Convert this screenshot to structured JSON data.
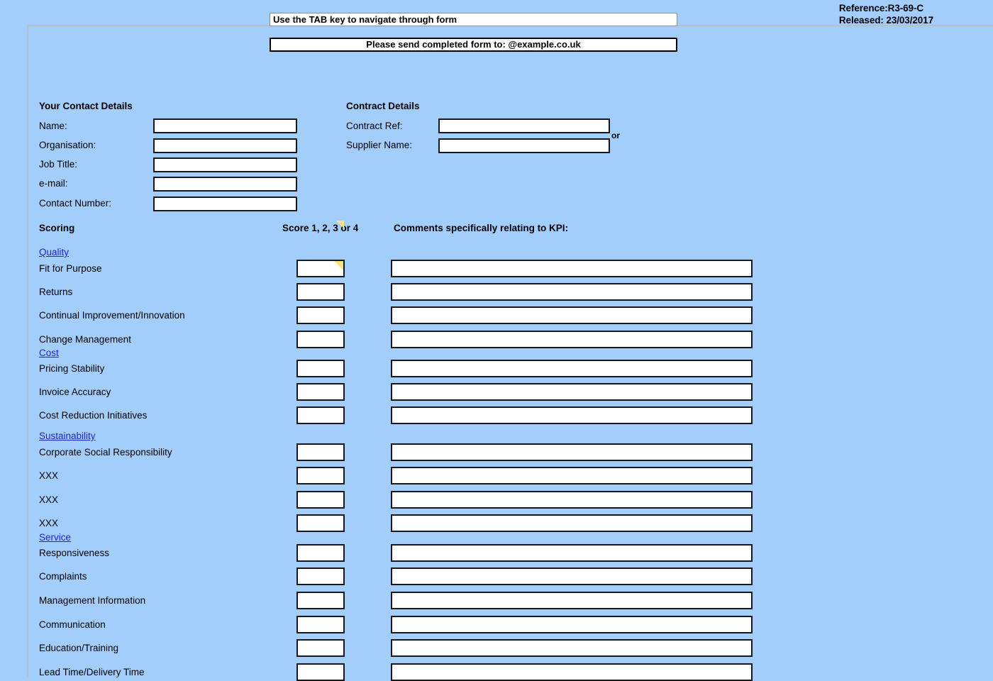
{
  "document": {
    "reference_label": "Reference:R3-69-C",
    "released_label": "Released: 23/03/2017"
  },
  "banners": {
    "tab_hint": "Use the TAB key to navigate through form",
    "send_to": "Please send completed form to: @example.co.uk"
  },
  "contact": {
    "heading": "Your Contact Details",
    "fields": [
      {
        "label": "Name:",
        "value": "",
        "placeholder": ""
      },
      {
        "label": "Organisation:",
        "value": "",
        "placeholder": ""
      },
      {
        "label": "Job Title:",
        "value": "",
        "placeholder": ""
      },
      {
        "label": "e-mail:",
        "value": "",
        "placeholder": ""
      },
      {
        "label": "Contact Number:",
        "value": "",
        "placeholder": ""
      }
    ]
  },
  "contract": {
    "heading": "Contract Details",
    "or_label": "or",
    "fields": [
      {
        "label": "Contract Ref:",
        "value": "",
        "placeholder": ""
      },
      {
        "label": "Supplier Name:",
        "value": "",
        "placeholder": ""
      }
    ]
  },
  "scoring": {
    "heading": "Scoring",
    "score_header": "Score 1, 2, 3 or 4",
    "comments_header": "Comments specifically relating to KPI:",
    "groups": [
      {
        "name": "Quality",
        "rows": [
          {
            "label": "Fit for Purpose",
            "score": "",
            "comment": "",
            "has_marker": true
          },
          {
            "label": "Returns",
            "score": "",
            "comment": "",
            "has_marker": false
          },
          {
            "label": "Continual Improvement/Innovation",
            "score": "",
            "comment": "",
            "has_marker": false
          },
          {
            "label": "Change Management",
            "score": "",
            "comment": "",
            "has_marker": false
          }
        ]
      },
      {
        "name": "Cost",
        "rows": [
          {
            "label": "Pricing Stability",
            "score": "",
            "comment": "",
            "has_marker": false
          },
          {
            "label": "Invoice Accuracy",
            "score": "",
            "comment": "",
            "has_marker": false
          },
          {
            "label": "Cost Reduction Initiatives",
            "score": "",
            "comment": "",
            "has_marker": false
          }
        ]
      },
      {
        "name": "Sustainability",
        "rows": [
          {
            "label": "Corporate Social Responsibility",
            "score": "",
            "comment": "",
            "has_marker": false
          },
          {
            "label": "XXX",
            "score": "",
            "comment": "",
            "has_marker": false
          },
          {
            "label": "XXX",
            "score": "",
            "comment": "",
            "has_marker": false
          },
          {
            "label": "XXX",
            "score": "",
            "comment": "",
            "has_marker": false
          }
        ]
      },
      {
        "name": "Service",
        "rows": [
          {
            "label": "Responsiveness",
            "score": "",
            "comment": "",
            "has_marker": false
          },
          {
            "label": "Complaints",
            "score": "",
            "comment": "",
            "has_marker": false
          },
          {
            "label": "Management Information",
            "score": "",
            "comment": "",
            "has_marker": false
          },
          {
            "label": "Communication",
            "score": "",
            "comment": "",
            "has_marker": false
          },
          {
            "label": "Education/Training",
            "score": "",
            "comment": "",
            "has_marker": false
          },
          {
            "label": "Lead Time/Delivery Time",
            "score": "",
            "comment": "",
            "has_marker": false
          }
        ]
      }
    ]
  },
  "colors": {
    "background": "#a3cdfb",
    "link": "#2323d6",
    "marker": "#f5e57f",
    "box_border": "#16181c",
    "sheet_border": "#b9bdc4"
  }
}
